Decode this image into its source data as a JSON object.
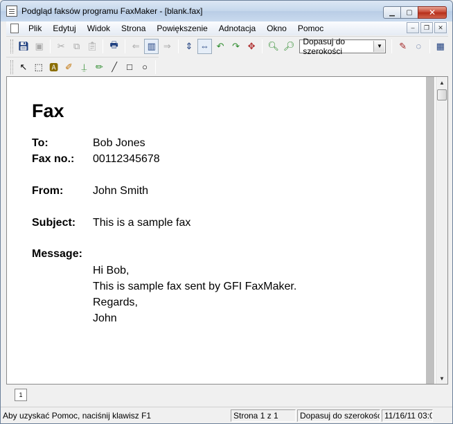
{
  "window": {
    "title": "Podgląd faksów programu FaxMaker - [blank.fax]"
  },
  "menu": [
    "Plik",
    "Edytuj",
    "Widok",
    "Strona",
    "Powiększenie",
    "Adnotacja",
    "Okno",
    "Pomoc"
  ],
  "toolbar": {
    "zoom_value": "Dopasuj do szerokości"
  },
  "fax": {
    "heading": "Fax",
    "fields": [
      {
        "label": "To:",
        "value": "Bob Jones"
      },
      {
        "label": "Fax no.:",
        "value": "00112345678"
      },
      {
        "label": "From:",
        "value": "John Smith"
      },
      {
        "label": "Subject:",
        "value": "This is a sample fax"
      },
      {
        "label": "Message:",
        "value": ""
      }
    ],
    "message_lines": [
      "Hi Bob,",
      "This is sample fax sent by GFI FaxMaker.",
      "Regards,",
      "John"
    ]
  },
  "tabs": {
    "page1": "1"
  },
  "status": {
    "help": "Aby uzyskać Pomoc, naciśnij klawisz F1",
    "page": "Strona 1 z 1",
    "zoom": "Dopasuj do szerokości",
    "datetime": "11/16/11 03:0"
  }
}
